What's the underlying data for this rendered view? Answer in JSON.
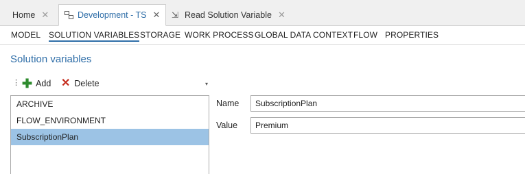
{
  "tabs": [
    {
      "label": "Home",
      "icon": "none"
    },
    {
      "label": "Development - TS",
      "icon": "flow-diagram-icon"
    },
    {
      "label": "Read Solution Variable",
      "icon": "step-icon"
    }
  ],
  "nav": [
    "MODEL",
    "SOLUTION VARIABLES",
    "STORAGE",
    "WORK PROCESS",
    "GLOBAL DATA CONTEXT",
    "FLOW",
    "PROPERTIES"
  ],
  "panel": {
    "title": "Solution variables"
  },
  "toolbar": {
    "add_label": "Add",
    "delete_label": "Delete"
  },
  "variables": [
    "ARCHIVE",
    "FLOW_ENVIRONMENT",
    "SubscriptionPlan"
  ],
  "selected_variable": "SubscriptionPlan",
  "properties": {
    "name_label": "Name",
    "name_value": "SubscriptionPlan",
    "value_label": "Value",
    "value_value": "Premium"
  },
  "colors": {
    "accent": "#2f6ea8",
    "selection": "#9cc3e5",
    "add": "#2e8b2e",
    "delete": "#c42b1c"
  }
}
